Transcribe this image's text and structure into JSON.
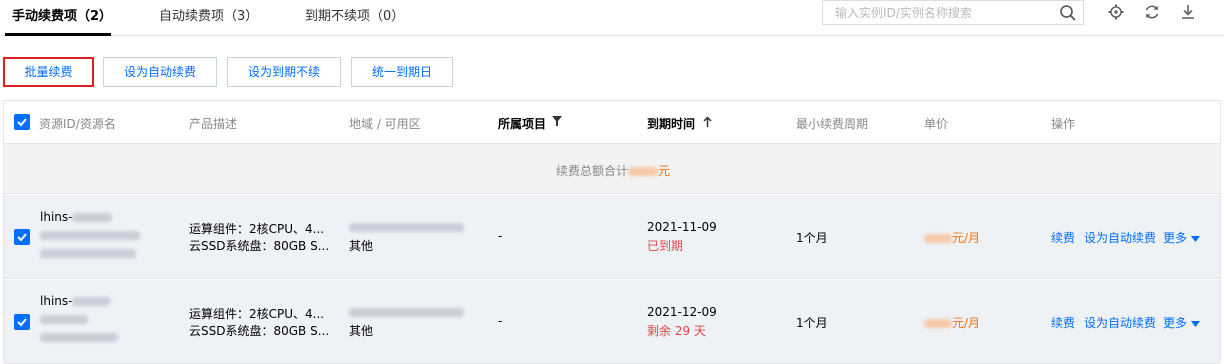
{
  "tabs": [
    {
      "label": "手动续费项（2）"
    },
    {
      "label": "自动续费项（3）"
    },
    {
      "label": "到期不续项（0）"
    }
  ],
  "search": {
    "placeholder": "输入实例ID/实例名称搜索"
  },
  "toolbar_icons": [
    "search-icon",
    "gear-icon",
    "refresh-icon",
    "download-icon"
  ],
  "actions": {
    "batch_renew": "批量续费",
    "set_auto_renew": "设为自动续费",
    "set_no_renew": "设为到期不续",
    "unify_expiry": "统一到期日"
  },
  "table": {
    "headers": {
      "resource": "资源ID/资源名",
      "product": "产品描述",
      "region": "地域 / 可用区",
      "project": "所属项目",
      "expiry": "到期时间",
      "min_period": "最小续费周期",
      "price": "单价",
      "ops": "操作"
    },
    "summary": {
      "prefix": "续费总额合计",
      "suffix": "元"
    },
    "rows": [
      {
        "id_prefix": "lhins-",
        "product_line1": "运算组件：2核CPU、4...",
        "product_line2": "云SSD系统盘：80GB S...",
        "region_line2": "其他",
        "project": "-",
        "expiry_date": "2021-11-09",
        "expiry_status": "已到期",
        "min_period": "1个月",
        "price_unit": "元/月",
        "op_renew": "续费",
        "op_auto": "设为自动续费",
        "op_more": "更多"
      },
      {
        "id_prefix": "lhins-",
        "product_line1": "运算组件：2核CPU、4...",
        "product_line2": "云SSD系统盘：80GB S...",
        "region_line2": "其他",
        "project": "-",
        "expiry_date": "2021-12-09",
        "expiry_status": "剩余 29 天",
        "min_period": "1个月",
        "price_unit": "元/月",
        "op_renew": "续费",
        "op_auto": "设为自动续费",
        "op_more": "更多"
      }
    ]
  },
  "colors": {
    "accent": "#006eff",
    "danger": "#e54545",
    "price": "#ff7200",
    "highlight_border": "#e02020"
  }
}
